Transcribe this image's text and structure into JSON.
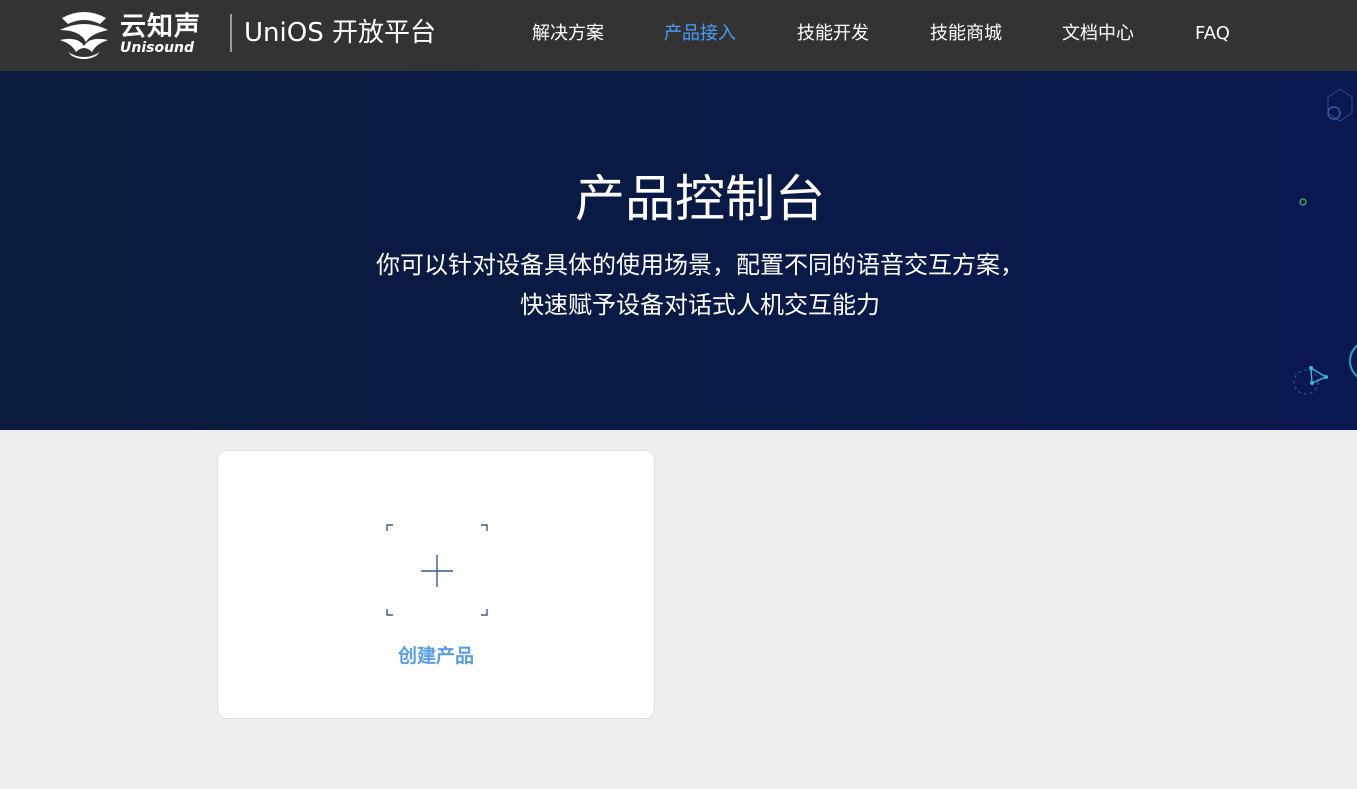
{
  "header": {
    "logo_cn": "云知声",
    "logo_en": "Unisound",
    "product_name": "UniOS 开放平台",
    "nav": [
      {
        "label": "解决方案",
        "active": false
      },
      {
        "label": "产品接入",
        "active": true
      },
      {
        "label": "技能开发",
        "active": false
      },
      {
        "label": "技能商城",
        "active": false
      },
      {
        "label": "文档中心",
        "active": false
      },
      {
        "label": "FAQ",
        "active": false
      }
    ]
  },
  "hero": {
    "title": "产品控制台",
    "desc_line1": "你可以针对设备具体的使用场景，配置不同的语音交互方案，",
    "desc_line2": "快速赋予设备对话式人机交互能力"
  },
  "create_card": {
    "label": "创建产品",
    "icon": "plus-icon"
  },
  "colors": {
    "topbar_bg": "#333333",
    "nav_active": "#4a9cff",
    "hero_bg": "#0a1b45",
    "page_bg": "#efefef",
    "card_label": "#5a9ee8",
    "plus_icon": "#3a5a8a"
  }
}
